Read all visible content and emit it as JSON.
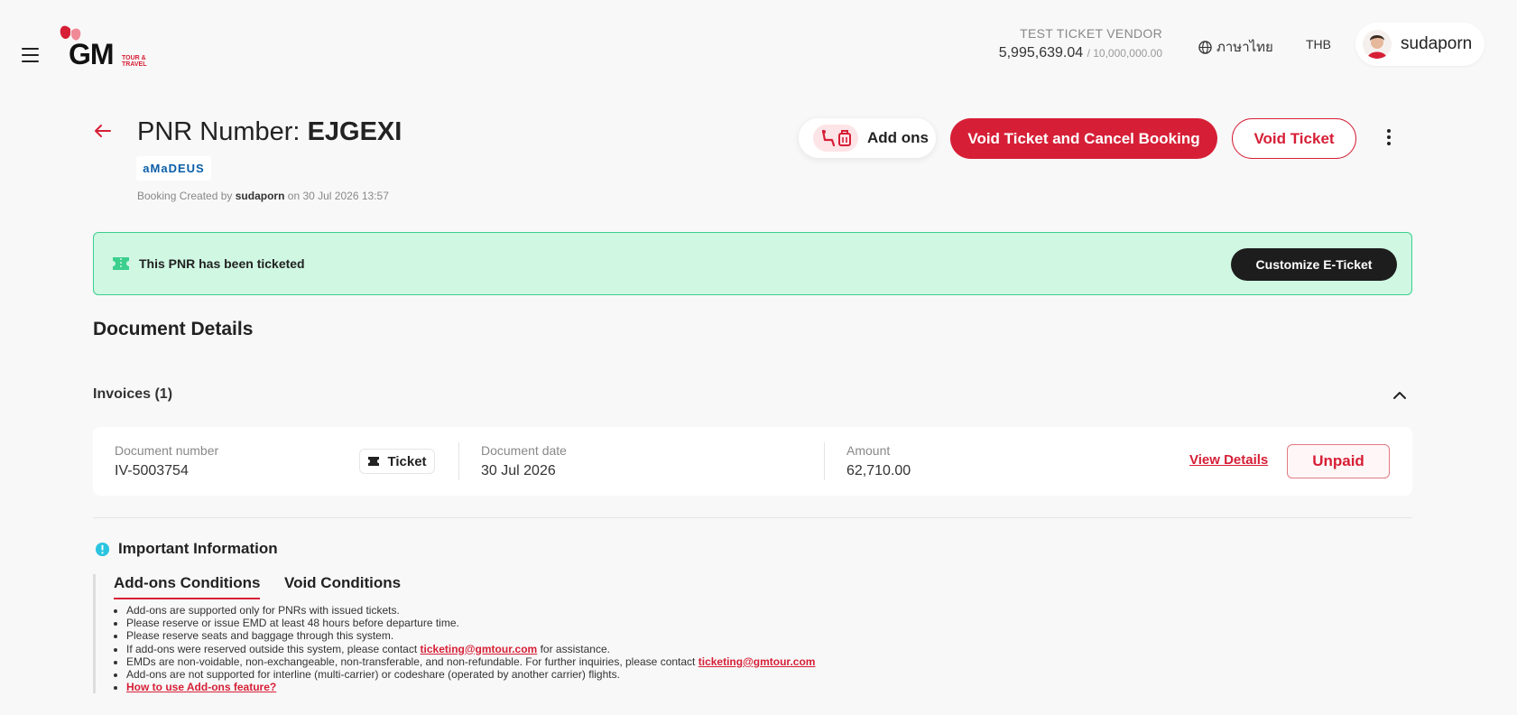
{
  "header": {
    "logo_text": "GM",
    "logo_sub_line1": "TOUR &",
    "logo_sub_line2": "TRAVEL",
    "vendor_name": "TEST TICKET VENDOR",
    "balance": "5,995,639.04",
    "limit": "/ 10,000,000.00",
    "language": "ภาษาไทย",
    "currency": "THB",
    "username": "sudaporn"
  },
  "booking": {
    "pnr_label": "PNR Number:",
    "pnr_value": "EJGEXI",
    "gds": "aMaDEUS",
    "created_prefix": "Booking Created by",
    "created_by": "sudaporn",
    "created_on": "on 30 Jul 2026 13:57"
  },
  "actions": {
    "addons": "Add ons",
    "void_cancel": "Void Ticket and Cancel Booking",
    "void": "Void Ticket"
  },
  "banner": {
    "text": "This PNR has been ticketed",
    "customize": "Customize E-Ticket"
  },
  "documents": {
    "title": "Document Details",
    "invoices_label": "Invoices (1)",
    "invoice": {
      "doc_number_label": "Document number",
      "doc_number": "IV-5003754",
      "type": "Ticket",
      "doc_date_label": "Document date",
      "doc_date": "30 Jul 2026",
      "amount_label": "Amount",
      "amount": "62,710.00",
      "view_details": "View Details",
      "status": "Unpaid"
    }
  },
  "info": {
    "title": "Important Information",
    "tabs": [
      "Add-ons Conditions",
      "Void Conditions"
    ],
    "conditions": {
      "c1": "Add-ons are supported only for PNRs with issued tickets.",
      "c2": "Please reserve or issue EMD at least 48 hours before departure time.",
      "c3": "Please reserve seats and baggage through this system.",
      "c4_pre": "If add-ons were reserved outside this system, please contact",
      "c4_link": "ticketing@gmtour.com",
      "c4_post": "for assistance.",
      "c5_pre": "EMDs are non-voidable, non-exchangeable, non-transferable, and non-refundable. For further inquiries, please contact",
      "c5_link": "ticketing@gmtour.com",
      "c6": "Add-ons are not supported for interline (multi-carrier) or codeshare (operated by another carrier) flights.",
      "c7_link": "How to use Add-ons feature?"
    }
  },
  "colors": {
    "brand": "#d61f36",
    "success_bg": "#cff7e2",
    "success_border": "#3ccf8e"
  }
}
